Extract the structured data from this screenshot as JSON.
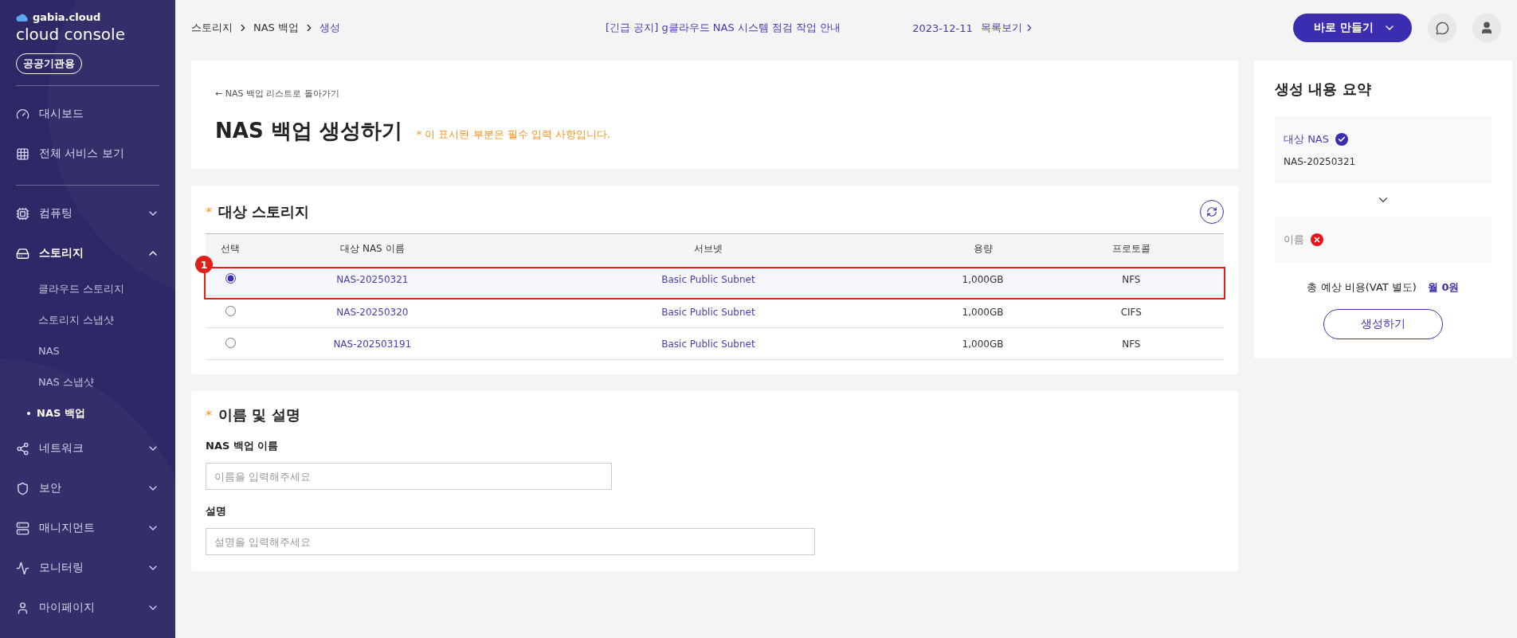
{
  "sidebar": {
    "logo": {
      "brand": "gabia.cloud",
      "product": "cloud console"
    },
    "badge": "공공기관용",
    "top_items": [
      {
        "label": "대시보드"
      },
      {
        "label": "전체 서비스 보기"
      }
    ],
    "groups": [
      {
        "label": "컴퓨팅",
        "expanded": false
      },
      {
        "label": "스토리지",
        "expanded": true,
        "children": [
          {
            "label": "클라우드 스토리지",
            "selected": false
          },
          {
            "label": "스토리지 스냅샷",
            "selected": false
          },
          {
            "label": "NAS",
            "selected": false
          },
          {
            "label": "NAS 스냅샷",
            "selected": false
          },
          {
            "label": "NAS 백업",
            "selected": true
          }
        ]
      },
      {
        "label": "네트워크",
        "expanded": false
      },
      {
        "label": "보안",
        "expanded": false
      },
      {
        "label": "매니지먼트",
        "expanded": false
      },
      {
        "label": "모니터링",
        "expanded": false
      },
      {
        "label": "마이페이지",
        "expanded": false
      }
    ]
  },
  "header": {
    "breadcrumb": [
      "스토리지",
      "NAS 백업",
      "생성"
    ],
    "notice": "[긴급 공지] g클라우드 NAS 시스템 점검 작업 안내",
    "notice_date": "2023-12-11",
    "notice_list_link": "목록보기",
    "create_button": "바로 만들기"
  },
  "page": {
    "back_link": "← NAS 백업 리스트로 돌아가기",
    "title": "NAS 백업 생성하기",
    "required_note": "* 이 표시된 부분은 필수 입력 사항입니다."
  },
  "storage_section": {
    "title": "대상 스토리지",
    "required_mark": "*",
    "columns": [
      "선택",
      "대상 NAS 이름",
      "서브넷",
      "용량",
      "프로토콜"
    ],
    "rows": [
      {
        "name": "NAS-20250321",
        "subnet": "Basic Public Subnet",
        "capacity": "1,000GB",
        "protocol": "NFS",
        "selected": true,
        "annotated": true
      },
      {
        "name": "NAS-20250320",
        "subnet": "Basic Public Subnet",
        "capacity": "1,000GB",
        "protocol": "CIFS",
        "selected": false,
        "annotated": false
      },
      {
        "name": "NAS-202503191",
        "subnet": "Basic Public Subnet",
        "capacity": "1,000GB",
        "protocol": "NFS",
        "selected": false,
        "annotated": false
      }
    ],
    "annotation": {
      "number": "1"
    }
  },
  "name_section": {
    "title": "이름 및 설명",
    "required_mark": "*",
    "fields": [
      {
        "label": "NAS 백업 이름",
        "placeholder": "이름을 입력해주세요"
      },
      {
        "label": "설명",
        "placeholder": "설명을 입력해주세요"
      }
    ]
  },
  "summary": {
    "title": "생성 내용 요약",
    "items": [
      {
        "label": "대상 NAS",
        "done": true,
        "value": "NAS-20250321"
      },
      {
        "label": "이름",
        "done": false
      }
    ],
    "cost_label": "총 예상 비용(VAT 별도)",
    "cost_value": "월 0원",
    "submit_button": "생성하기"
  }
}
